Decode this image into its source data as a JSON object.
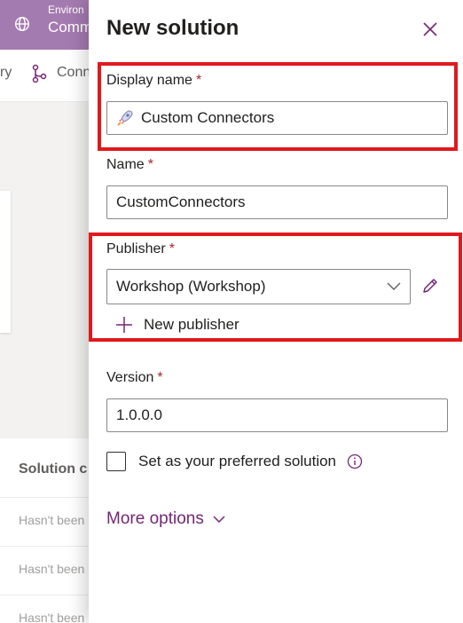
{
  "background": {
    "env_label": "Environ",
    "env_name": "Comm",
    "toolbar_item1": "ry",
    "toolbar_item2": "Conn",
    "list_header": "Solution c",
    "rows": [
      "Hasn't been",
      "Hasn't been",
      "Hasn't been"
    ]
  },
  "panel": {
    "title": "New solution",
    "display_name": {
      "label": "Display name",
      "required": "*",
      "value": "Custom Connectors"
    },
    "name": {
      "label": "Name",
      "required": "*",
      "value": "CustomConnectors"
    },
    "publisher": {
      "label": "Publisher",
      "required": "*",
      "value": "Workshop (Workshop)",
      "new_label": "New publisher"
    },
    "version": {
      "label": "Version",
      "required": "*",
      "value": "1.0.0.0"
    },
    "preferred": {
      "label": "Set as your preferred solution",
      "checked": false
    },
    "more_options": "More options"
  },
  "colors": {
    "header": "#a47bb0",
    "accent": "#742774",
    "highlight": "#e0191d",
    "required": "#a4262c"
  },
  "icons": {
    "close": "close-icon",
    "rocket": "rocket-icon",
    "chevron": "chevron-down-icon",
    "pencil": "pencil-icon",
    "plus": "plus-icon",
    "info": "info-icon"
  }
}
